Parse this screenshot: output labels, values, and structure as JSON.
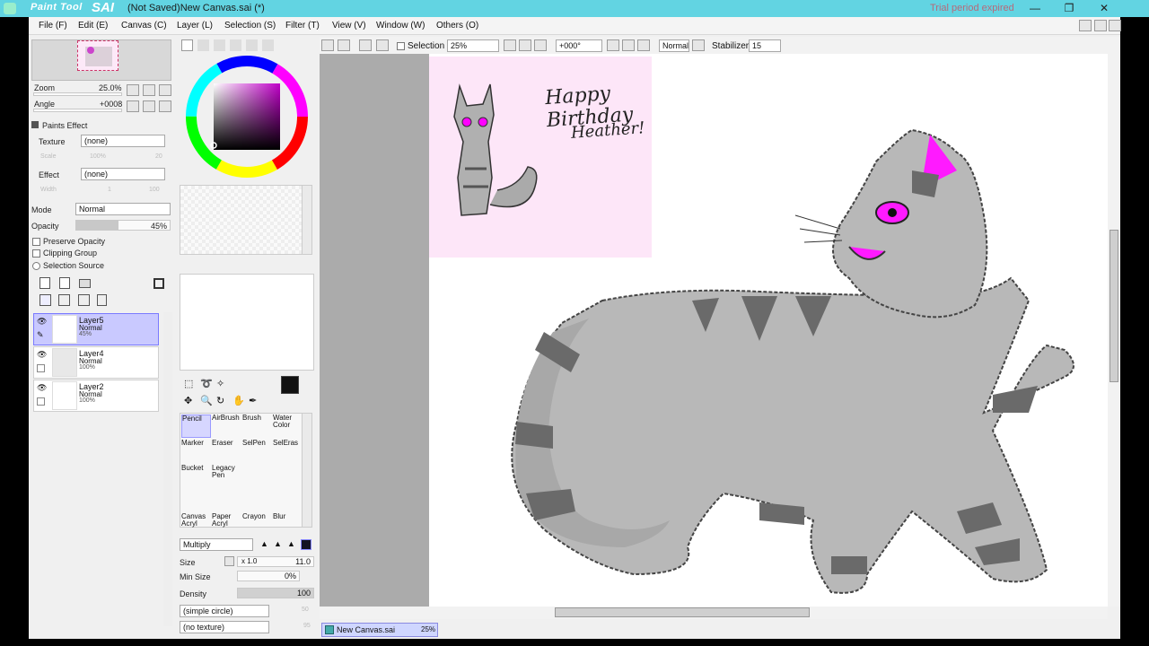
{
  "window": {
    "logo_text": "Paint Tool",
    "logo_sai": "SAI",
    "title": "(Not Saved)New Canvas.sai (*)",
    "trial": "Trial period expired",
    "min": "—",
    "max": "❐",
    "close": "✕"
  },
  "menu": [
    "File (F)",
    "Edit (E)",
    "Canvas (C)",
    "Layer (L)",
    "Selection (S)",
    "Filter (T)",
    "View (V)",
    "Window (W)",
    "Others (O)"
  ],
  "nav": {
    "zoom_label": "Zoom",
    "zoom_value": "25.0%",
    "angle_label": "Angle",
    "angle_value": "+0008"
  },
  "paints_effect": {
    "header": "Paints Effect",
    "texture_label": "Texture",
    "texture_value": "(none)",
    "scale_label": "Scale",
    "scale_value": "100%",
    "scale_num": "20",
    "effect_label": "Effect",
    "effect_value": "(none)",
    "width_label": "Width",
    "width_value": "1",
    "width_num": "100"
  },
  "layer_props": {
    "mode_label": "Mode",
    "mode_value": "Normal",
    "opacity_label": "Opacity",
    "opacity_value": "45%",
    "opacity_fraction": 0.45,
    "preserve_opacity": "Preserve Opacity",
    "clipping_group": "Clipping Group",
    "selection_source": "Selection Source"
  },
  "layers": [
    {
      "name": "Layer5",
      "mode": "Normal",
      "opacity": "45%",
      "selected": true
    },
    {
      "name": "Layer4",
      "mode": "Normal",
      "opacity": "100%",
      "selected": false
    },
    {
      "name": "Layer2",
      "mode": "Normal",
      "opacity": "100%",
      "selected": false
    }
  ],
  "toolbar": {
    "selection_label": "Selection",
    "zoom_value": "25%",
    "angle_value": "+000°",
    "mode_value": "Normal",
    "stabilizer_label": "Stabilizer",
    "stabilizer_value": "15"
  },
  "tools": [
    {
      "label": "Pencil"
    },
    {
      "label": "AirBrush"
    },
    {
      "label": "Brush"
    },
    {
      "label": "Water Color"
    },
    {
      "label": "Marker"
    },
    {
      "label": "Eraser"
    },
    {
      "label": "SelPen"
    },
    {
      "label": "SelEras"
    },
    {
      "label": "Bucket"
    },
    {
      "label": "Legacy Pen"
    },
    {
      "label": "Canvas Acryl"
    },
    {
      "label": "Paper Acryl"
    },
    {
      "label": "Crayon"
    },
    {
      "label": "Blur"
    }
  ],
  "brush": {
    "blend_mode": "Multiply",
    "size_label": "Size",
    "size_mult": "x 1.0",
    "size_value": "11.0",
    "minsize_label": "Min Size",
    "minsize_value": "0%",
    "density_label": "Density",
    "density_value": "100",
    "shape_value": "(simple circle)",
    "shape_num": "50",
    "texture_value": "(no texture)",
    "texture_num": "95"
  },
  "status": {
    "tab_name": "New Canvas.sai",
    "tab_zoom": "25%"
  },
  "drawing": {
    "birthday_line1": "Happy Birthday",
    "birthday_line2": "Heather!"
  },
  "colors": {
    "titlebar": "#62d4e2",
    "selected_layer": "#c9c9ff",
    "canvas_bg": "#ababab",
    "birthday_bg": "#fde6f8",
    "accent_pink": "#ff1aff"
  }
}
